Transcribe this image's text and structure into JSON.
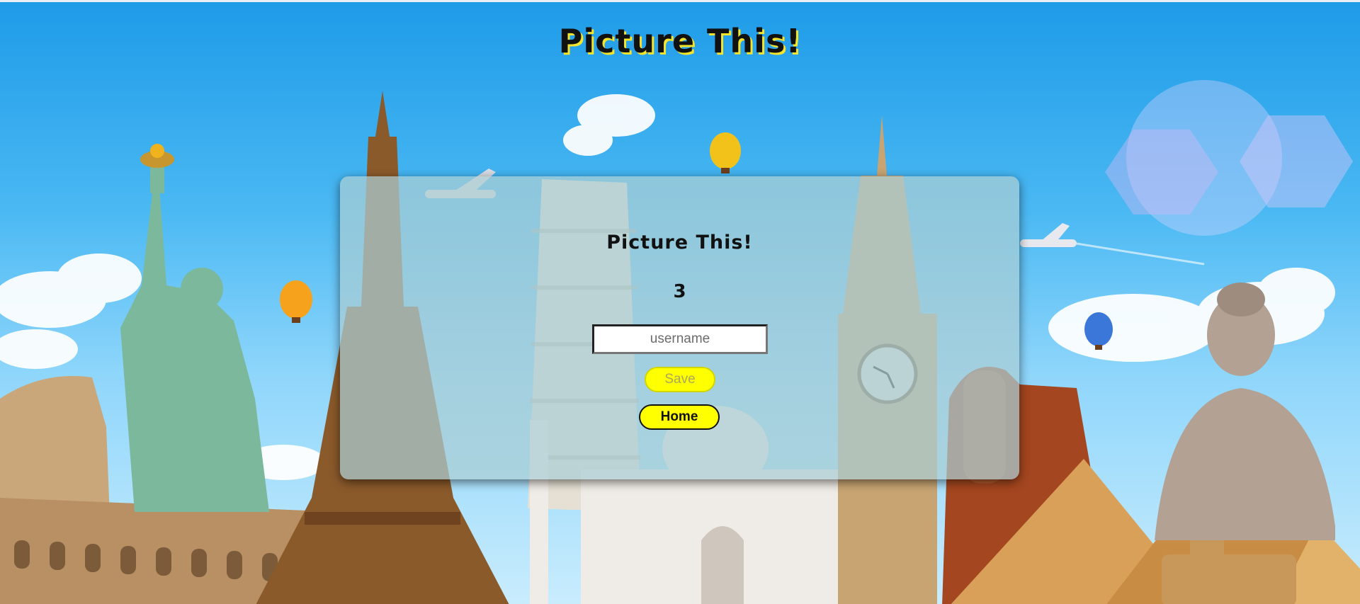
{
  "header": {
    "title": "Picture This!"
  },
  "card": {
    "title": "Picture This!",
    "score": "3",
    "username_placeholder": "username",
    "save_label": "Save",
    "home_label": "Home"
  },
  "colors": {
    "sky": "#1e9be8",
    "card_bg": "#aacdd4",
    "button_yellow": "#ffff00",
    "title_shadow": "#f4e52c"
  }
}
